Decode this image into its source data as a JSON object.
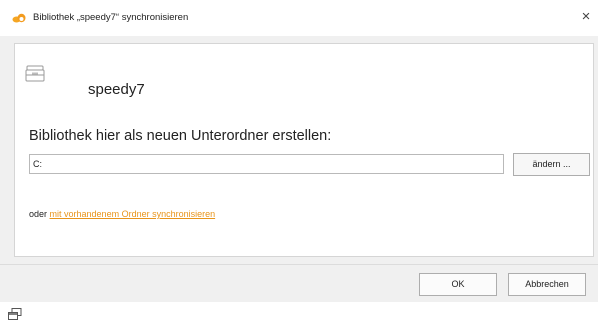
{
  "window": {
    "title": "Bibliothek „speedy7“ synchronisieren",
    "app_icon": "seafile-logo-icon",
    "close_label": "×"
  },
  "library": {
    "icon": "library-icon",
    "name": "speedy7"
  },
  "create_label": "Bibliothek hier als neuen Unterordner erstellen:",
  "path_input": {
    "value": "C:"
  },
  "change_button": "ändern ...",
  "sync": {
    "prefix": "oder",
    "link": "mit vorhandenem Ordner synchronisieren"
  },
  "buttons": {
    "ok": "OK",
    "cancel": "Abbrechen"
  },
  "footer": {
    "icon": "window-restore-icon"
  },
  "colors": {
    "link": "#e8941a",
    "accent": "#f39c1f"
  }
}
